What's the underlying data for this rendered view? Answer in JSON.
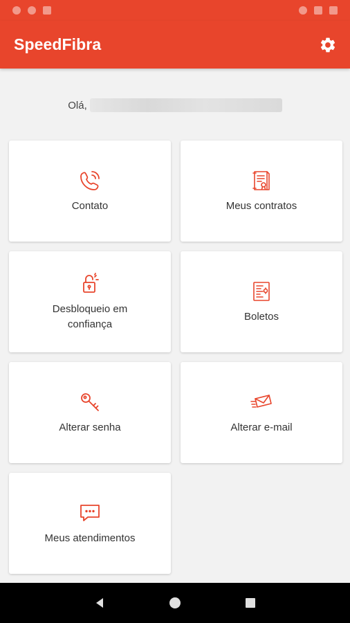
{
  "app": {
    "title": "SpeedFibra",
    "accent_color": "#e8452c",
    "settings_icon": "gear-icon"
  },
  "greeting": {
    "prefix": "Olá,"
  },
  "menu": [
    {
      "label": "Contato",
      "icon": "phone-icon"
    },
    {
      "label": "Meus contratos",
      "icon": "contract-icon"
    },
    {
      "label": "Desbloqueio em confiança",
      "icon": "unlock-icon"
    },
    {
      "label": "Boletos",
      "icon": "invoice-icon"
    },
    {
      "label": "Alterar senha",
      "icon": "key-icon"
    },
    {
      "label": "Alterar e-mail",
      "icon": "envelope-icon"
    },
    {
      "label": "Meus atendimentos",
      "icon": "chat-icon"
    }
  ],
  "navigation": {
    "back_icon": "back-icon",
    "home_icon": "home-icon",
    "recents_icon": "recents-icon"
  }
}
